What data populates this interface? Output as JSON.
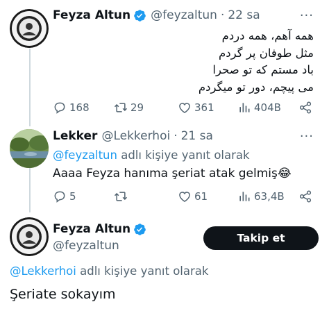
{
  "tweet1": {
    "name": "Feyza Altun",
    "handle": "@feyzaltun",
    "time": "22 sa",
    "lines": [
      "همه آهم، همه دردم",
      "مثل طوفان پر گردم",
      "باد مستم که تو صحرا",
      "می پیچم، دور تو میگردم"
    ],
    "stats": {
      "replies": "168",
      "retweets": "29",
      "likes": "361",
      "views": "404B"
    }
  },
  "tweet2": {
    "name": "Lekker",
    "handle": "@Lekkerhoi",
    "time": "21 sa",
    "reply_mention": "@feyzaltun",
    "reply_suffix": " adlı kişiye yanıt olarak",
    "text": "Aaaa Feyza hanıma şeriat atak gelmiş😂",
    "stats": {
      "replies": "5",
      "retweets": "",
      "likes": "61",
      "views": "63,4B"
    }
  },
  "tweet3": {
    "name": "Feyza Altun",
    "handle": "@feyzaltun",
    "follow_label": "Takip et",
    "reply_mention": "@Lekkerhoi",
    "reply_suffix": " adlı kişiye yanıt olarak",
    "text": "Şeriate sokayım"
  },
  "common": {
    "dot": "·",
    "more": "···"
  },
  "colors": {
    "accent": "#1d9bf0",
    "muted": "#536471",
    "text": "#0f1419",
    "thread": "#cfd9de",
    "button": "#0f1419"
  },
  "icons": [
    "verified-badge-icon",
    "more-icon",
    "reply-icon",
    "retweet-icon",
    "like-icon",
    "views-icon",
    "share-icon"
  ]
}
